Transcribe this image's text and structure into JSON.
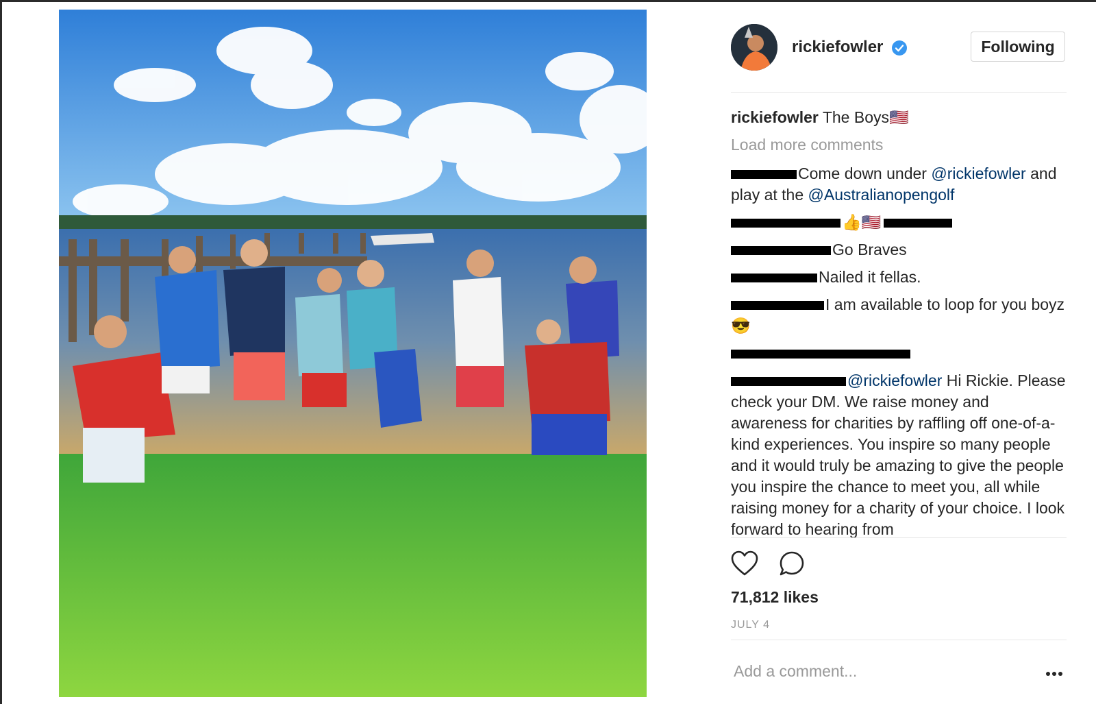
{
  "post": {
    "image_alt": "Group photo",
    "author": {
      "username": "rickiefowler",
      "verified_icon": "verified-badge-icon"
    },
    "follow_button_label": "Following",
    "caption": {
      "username": "rickiefowler",
      "text": "The Boys🇺🇸"
    },
    "load_more_label": "Load more comments",
    "comments": [
      {
        "redacted": true,
        "text": "Come down under ",
        "mention": "@rickiefowler",
        "text2": " and play at the ",
        "mention2": "@Australianopengolf"
      },
      {
        "redacted": true,
        "text": "",
        "emoji": "👍🇺🇸"
      },
      {
        "redacted": true,
        "text": "Go Braves"
      },
      {
        "redacted": true,
        "text": "Nailed it fellas."
      },
      {
        "redacted": true,
        "text": "I am available to loop for you boyz 😎"
      },
      {
        "redacted": true,
        "text": ""
      },
      {
        "redacted": true,
        "mention": "@rickiefowler",
        "text": " Hi Rickie. Please check your DM. We raise money and awareness for charities by raffling off one-of-a-kind experiences. You inspire so many people and it would truly be amazing to give the people you inspire the chance to meet you, all while raising money for a charity of your choice. I look forward to hearing from"
      }
    ],
    "actions": {
      "like_icon": "heart-icon",
      "comment_icon": "comment-bubble-icon"
    },
    "likes": "71,812 likes",
    "date": "JULY 4",
    "add_comment_placeholder": "Add a comment...",
    "more_icon": "more-options-icon"
  },
  "colors": {
    "mention": "#003569",
    "muted": "#999999",
    "verified": "#3897f0",
    "text": "#262626"
  }
}
